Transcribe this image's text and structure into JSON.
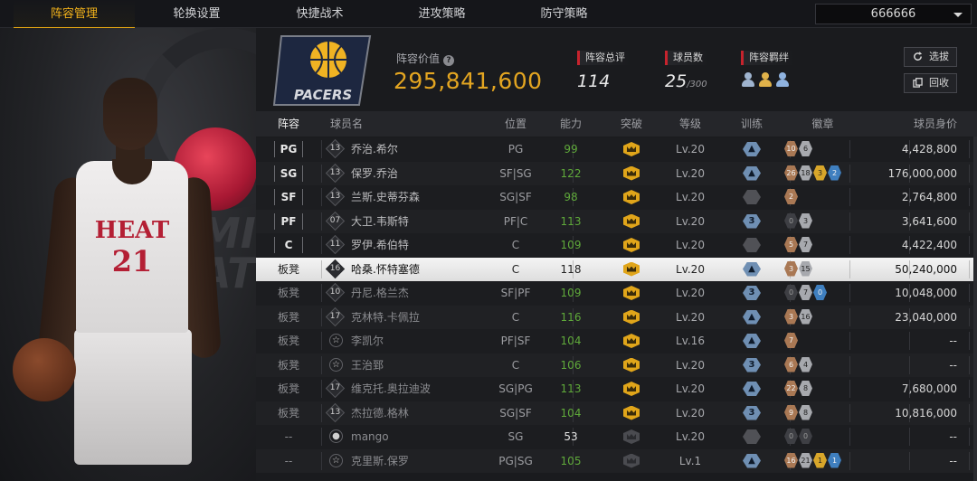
{
  "nav": {
    "tabs": [
      {
        "label": "阵容管理",
        "active": true
      },
      {
        "label": "轮换设置",
        "active": false
      },
      {
        "label": "快捷战术",
        "active": false
      },
      {
        "label": "进攻策略",
        "active": false
      },
      {
        "label": "防守策略",
        "active": false
      }
    ],
    "account_select": "666666"
  },
  "showcase": {
    "jersey_team": "HEAT",
    "jersey_number": "21",
    "bg_text": "MI\nAT"
  },
  "team": {
    "logo_text": "PACERS",
    "value_label": "阵容价值",
    "value": "295,841,600",
    "overall_label": "阵容总评",
    "overall": "114",
    "count_label": "球员数",
    "count": "25",
    "count_max": "/300",
    "bond_label": "阵容羁绊",
    "bond_icons": [
      "#9fb4cf",
      "#e0b24a",
      "#8fb3e0"
    ]
  },
  "buttons": {
    "pick": "选拔",
    "recycle": "回收"
  },
  "colors": {
    "accent": "#e3a521",
    "tab_active": "#f2b21b",
    "ability": "#5fa93a"
  },
  "table": {
    "headers": {
      "role": "阵容",
      "name": "球员名",
      "pos": "位置",
      "ability": "能力",
      "breakthrough": "突破",
      "level": "等级",
      "training": "训练",
      "badges": "徽章",
      "price": "球员身价"
    },
    "rows": [
      {
        "role": "PG",
        "starter": true,
        "num": "13",
        "name": "乔治.希尔",
        "pos": "PG",
        "ability": "99",
        "crown": true,
        "level": "Lv.20",
        "train": "",
        "badges": [
          [
            "10",
            "bronze"
          ],
          [
            "6",
            "silver"
          ]
        ],
        "price": "4,428,800"
      },
      {
        "role": "SG",
        "starter": true,
        "num": "13",
        "name": "保罗.乔治",
        "pos": "SF|SG",
        "ability": "122",
        "crown": true,
        "level": "Lv.20",
        "train": "",
        "badges": [
          [
            "26",
            "bronze"
          ],
          [
            "18",
            "silver"
          ],
          [
            "3",
            "gold"
          ],
          [
            "2",
            "blue"
          ]
        ],
        "price": "176,000,000"
      },
      {
        "role": "SF",
        "starter": true,
        "num": "13",
        "name": "兰斯.史蒂芬森",
        "pos": "SG|SF",
        "ability": "98",
        "crown": true,
        "level": "Lv.20",
        "train": "off",
        "badges": [
          [
            "2",
            "bronze"
          ]
        ],
        "price": "2,764,800"
      },
      {
        "role": "PF",
        "starter": true,
        "num": "07",
        "name": "大卫.韦斯特",
        "pos": "PF|C",
        "ability": "113",
        "crown": true,
        "level": "Lv.20",
        "train": "3",
        "badges": [
          [
            "0",
            "dark"
          ],
          [
            "3",
            "silver"
          ]
        ],
        "price": "3,641,600"
      },
      {
        "role": "C",
        "starter": true,
        "num": "11",
        "name": "罗伊.希伯特",
        "pos": "C",
        "ability": "109",
        "crown": true,
        "level": "Lv.20",
        "train": "off",
        "badges": [
          [
            "5",
            "bronze"
          ],
          [
            "7",
            "silver"
          ]
        ],
        "price": "4,422,400"
      },
      {
        "role": "板凳",
        "starter": false,
        "hl": true,
        "num": "16",
        "name": "哈桑.怀特塞德",
        "pos": "C",
        "ability": "118",
        "crown": true,
        "level": "Lv.20",
        "train": "",
        "badges": [
          [
            "3",
            "bronze"
          ],
          [
            "15",
            "silver"
          ]
        ],
        "price": "50,240,000"
      },
      {
        "role": "板凳",
        "starter": false,
        "num": "10",
        "name": "丹尼.格兰杰",
        "pos": "SF|PF",
        "ability": "109",
        "crown": true,
        "level": "Lv.20",
        "train": "3",
        "badges": [
          [
            "0",
            "dark"
          ],
          [
            "7",
            "silver"
          ],
          [
            "0",
            "blue"
          ]
        ],
        "price": "10,048,000"
      },
      {
        "role": "板凳",
        "starter": false,
        "num": "17",
        "name": "克林特.卡佩拉",
        "pos": "C",
        "ability": "116",
        "crown": true,
        "level": "Lv.20",
        "train": "",
        "badges": [
          [
            "3",
            "bronze"
          ],
          [
            "16",
            "silver"
          ]
        ],
        "price": "23,040,000"
      },
      {
        "role": "板凳",
        "starter": false,
        "star": true,
        "name": "李凯尔",
        "pos": "PF|SF",
        "ability": "104",
        "crown": true,
        "level": "Lv.16",
        "train": "",
        "badges": [
          [
            "7",
            "bronze"
          ]
        ],
        "price": "--"
      },
      {
        "role": "板凳",
        "starter": false,
        "star": true,
        "name": "王治郅",
        "pos": "C",
        "ability": "106",
        "crown": true,
        "level": "Lv.20",
        "train": "3",
        "badges": [
          [
            "6",
            "bronze"
          ],
          [
            "4",
            "silver"
          ]
        ],
        "price": "--"
      },
      {
        "role": "板凳",
        "starter": false,
        "num": "17",
        "name": "维克托.奥拉迪波",
        "pos": "SG|PG",
        "ability": "113",
        "crown": true,
        "level": "Lv.20",
        "train": "",
        "badges": [
          [
            "22",
            "bronze"
          ],
          [
            "8",
            "silver"
          ]
        ],
        "price": "7,680,000"
      },
      {
        "role": "板凳",
        "starter": false,
        "num": "13",
        "name": "杰拉德.格林",
        "pos": "SG|SF",
        "ability": "104",
        "crown": true,
        "level": "Lv.20",
        "train": "3",
        "badges": [
          [
            "9",
            "bronze"
          ],
          [
            "8",
            "silver"
          ]
        ],
        "price": "10,816,000"
      },
      {
        "role": "--",
        "starter": false,
        "person": true,
        "name": "mango",
        "pos": "SG",
        "ability": "53",
        "white": true,
        "crown": false,
        "level": "Lv.20",
        "train": "off",
        "badges": [
          [
            "0",
            "dark"
          ],
          [
            "0",
            "dark"
          ]
        ],
        "price": "--"
      },
      {
        "role": "--",
        "starter": false,
        "star": true,
        "name": "克里斯.保罗",
        "pos": "PG|SG",
        "ability": "105",
        "crown": false,
        "level": "Lv.1",
        "train": "",
        "badges": [
          [
            "16",
            "bronze"
          ],
          [
            "21",
            "silver"
          ],
          [
            "1",
            "gold"
          ],
          [
            "1",
            "blue"
          ]
        ],
        "price": "--"
      }
    ]
  }
}
